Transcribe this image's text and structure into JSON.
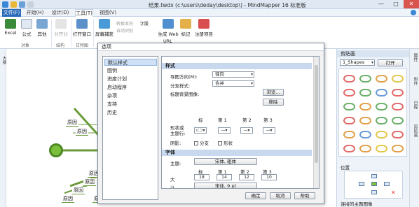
{
  "window": {
    "title": "结果.twdx (c:\\users\\deday\\desktop\\) - MindMapper 16 标准版",
    "controls": [
      "—",
      "□",
      "✕"
    ]
  },
  "tabs": [
    "文件(F)",
    "开始(H)",
    "设计(D)",
    "工具(T)",
    "视图(V)"
  ],
  "ribbon": {
    "excel": "Excel",
    "formula": "公式",
    "other": "其他",
    "split": "分开分",
    "open_window": "打开窗口",
    "screen_capture": "屏幕捕获",
    "convert_text": "转换本符",
    "auto_recognize": "自动识别",
    "dictionary": "字股",
    "generate_web": "生成 Web",
    "url": "URL",
    "marker": "标记",
    "register": "注册项目",
    "groups": [
      "对象",
      "结构",
      "甘特图"
    ]
  },
  "canvas": {
    "left_strip": "大纲",
    "nodes": [
      "原因",
      "原因",
      "原因",
      "原因",
      "原因",
      "原因",
      "原因"
    ]
  },
  "dialog": {
    "title": "选项",
    "categories": [
      "默认样式",
      "图例",
      "进度计划",
      "启动程序",
      "杂项",
      "支持",
      "历史"
    ],
    "selected_category": "默认样式",
    "section_style": "样式",
    "layout_label": "导图方向(M):",
    "layout_value": "径向",
    "branch_label": "分支样式:",
    "branch_value": "合并",
    "bg_label": "标题背景图像:",
    "browse": "浏览...",
    "remove": "移除",
    "shape_label": "形状或",
    "line_label": "主题行:",
    "shape_cols": [
      "标",
      "第 1",
      "第 2",
      "第 3"
    ],
    "shadow_label": "阴影:",
    "branch_cb": "分支",
    "shape_cb": "形状",
    "section_font": "字体",
    "topic_label": "主题:",
    "topic_font": "宋体, 粗体",
    "size_label": "大",
    "size_cols": [
      "标",
      "第 1",
      "第 2",
      "第 3"
    ],
    "sizes": [
      "18",
      "14",
      "12",
      "10"
    ],
    "note_label": "注",
    "note_font": "宋体, 9 pt",
    "ok": "确定",
    "cancel": "取消",
    "help": "帮助"
  },
  "right_panel": {
    "title": "剪贴画",
    "dropdown": "1_Shapes",
    "open": "打开",
    "position_label": "位置",
    "connect_image": "连接的主题图像"
  },
  "right_strip": [
    "属性",
    "附件",
    "日程",
    "剪贴画"
  ],
  "colors": {
    "accent": "#2b6cb8",
    "node_line": "#6a9a3a",
    "root": "#7bbf3a"
  }
}
